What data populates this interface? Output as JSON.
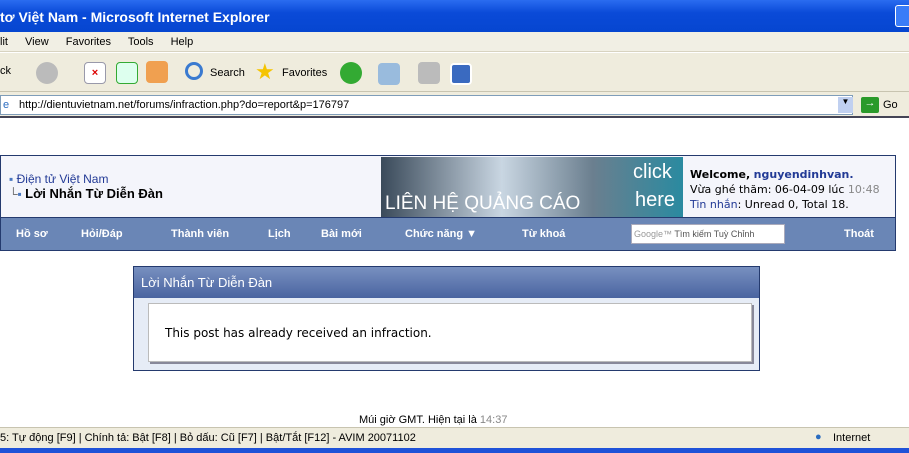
{
  "window": {
    "title": "tơ Việt Nam - Microsoft Internet Explorer"
  },
  "menu": [
    "lit",
    "View",
    "Favorites",
    "Tools",
    "Help"
  ],
  "toolbar": {
    "back": "ck",
    "search": "Search",
    "favorites": "Favorites"
  },
  "address": {
    "url": "http://dientuvietnam.net/forums/infraction.php?do=report&p=176797",
    "go": "Go"
  },
  "breadcrumb": {
    "root": "Điện tử Việt Nam",
    "current": "Lời Nhắn Từ Diễn Đàn"
  },
  "banner": {
    "text": "LIÊN HỆ QUẢNG CÁO",
    "click": "click",
    "here": "here"
  },
  "welcome": {
    "label": "Welcome,",
    "user": "nguyendinhvan.",
    "last_visit_label": "Vừa ghé thăm: 06-04-09 lúc",
    "last_visit_time": "10:48",
    "pm_label": "Tin nhắn",
    "pm_text": ": Unread 0, Total 18."
  },
  "nav": [
    "Hồ sơ",
    "Hỏi/Đáp",
    "Thành viên",
    "Lịch",
    "Bài mới",
    "Chức năng ▼",
    "Từ khoá",
    "Thoát"
  ],
  "search": {
    "logo": "Google™",
    "placeholder": "Tìm kiếm Tuỳ Chỉnh"
  },
  "message": {
    "title": "Lời Nhắn Từ Diễn Đàn",
    "body": "This post has already received an infraction."
  },
  "footer": {
    "time_label": "Múi giờ GMT. Hiện tại là",
    "time": "14:37"
  },
  "status": {
    "text": "5: Tự động [F9] | Chính tả: Bật [F8] | Bỏ dấu: Cũ [F7] | Bật/Tắt [F12] - AVIM 20071102",
    "zone": "Internet"
  }
}
